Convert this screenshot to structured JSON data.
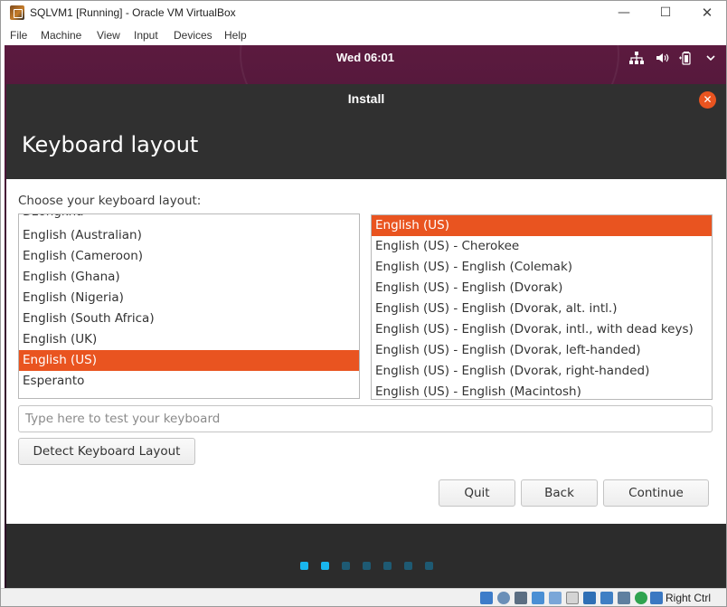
{
  "window": {
    "title": "SQLVM1 [Running] - Oracle VM VirtualBox",
    "controls": {
      "minimize": "—",
      "maximize": "☐",
      "close": "✕"
    }
  },
  "menubar": {
    "items": [
      "File",
      "Machine",
      "View",
      "Input",
      "Devices",
      "Help"
    ]
  },
  "guest_topbar": {
    "clock": "Wed 06:01",
    "tray_icons": [
      "network-icon",
      "volume-icon",
      "battery-icon",
      "system-menu-chevron-icon"
    ]
  },
  "installer": {
    "title": "Install",
    "close_icon": "✕",
    "heading": "Keyboard layout",
    "prompt": "Choose your keyboard layout:",
    "layouts": [
      "Dzongkha",
      "English (Australian)",
      "English (Cameroon)",
      "English (Ghana)",
      "English (Nigeria)",
      "English (South Africa)",
      "English (UK)",
      "English (US)",
      "Esperanto"
    ],
    "selected_layout": "English (US)",
    "variants": [
      "English (US)",
      "English (US) - Cherokee",
      "English (US) - English (Colemak)",
      "English (US) - English (Dvorak)",
      "English (US) - English (Dvorak, alt. intl.)",
      "English (US) - English (Dvorak, intl., with dead keys)",
      "English (US) - English (Dvorak, left-handed)",
      "English (US) - English (Dvorak, right-handed)",
      "English (US) - English (Macintosh)"
    ],
    "selected_variant": "English (US)",
    "test_placeholder": "Type here to test your keyboard",
    "detect_button": "Detect Keyboard Layout",
    "buttons": {
      "quit": "Quit",
      "back": "Back",
      "continue": "Continue"
    },
    "progress": {
      "total_steps": 7,
      "active_step": 2
    }
  },
  "statusbar": {
    "host_key": "Right Ctrl"
  },
  "colors": {
    "accent": "#e95420",
    "dialog_header": "#303030",
    "footer": "#2c2c2c",
    "dot_active": "#19b6ee",
    "dot_inactive": "#1e5a73"
  }
}
